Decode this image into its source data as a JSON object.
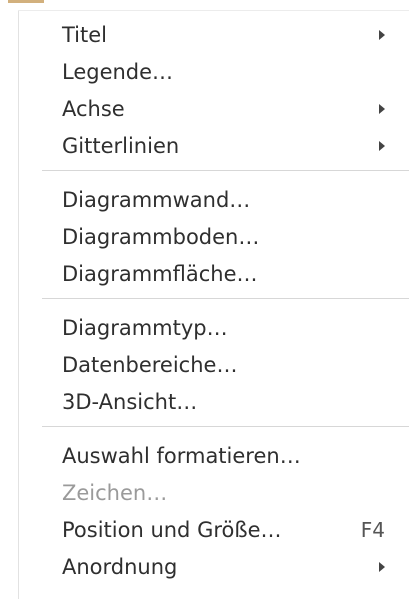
{
  "menu": {
    "items": [
      {
        "label": "Titel",
        "submenu": true
      },
      {
        "label": "Legende…"
      },
      {
        "label": "Achse",
        "submenu": true
      },
      {
        "label": "Gitterlinien",
        "submenu": true
      },
      {
        "label": "Diagrammwand…"
      },
      {
        "label": "Diagrammboden…"
      },
      {
        "label": "Diagrammfläche…"
      },
      {
        "label": "Diagrammtyp…"
      },
      {
        "label": "Datenbereiche…"
      },
      {
        "label": "3D-Ansicht…"
      },
      {
        "label": "Auswahl formatieren…"
      },
      {
        "label": "Zeichen…",
        "disabled": true
      },
      {
        "label": "Position und Größe…",
        "shortcut": "F4"
      },
      {
        "label": "Anordnung",
        "submenu": true
      }
    ]
  },
  "colors": {
    "text": "#2f2f2f",
    "disabled_text": "#9a9a9a",
    "separator": "#d7d7d7",
    "accent": "#d2b07d"
  }
}
